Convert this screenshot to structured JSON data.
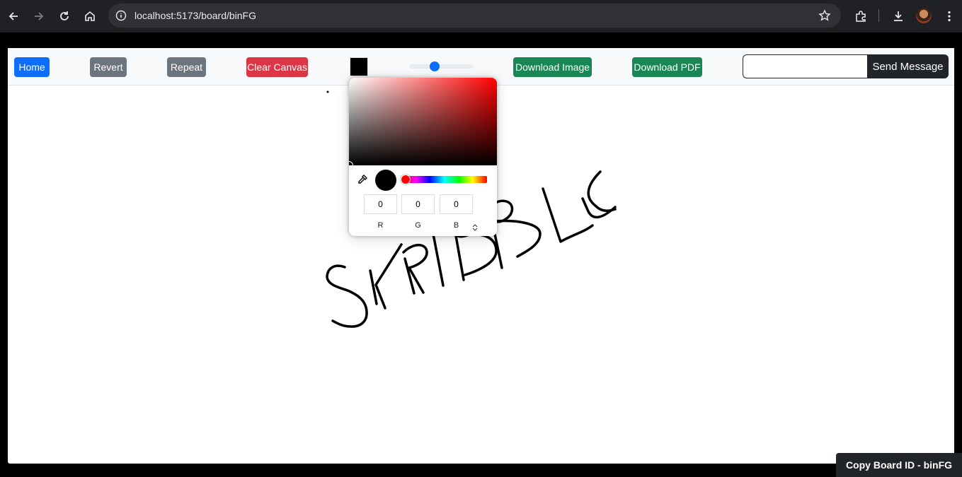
{
  "browser": {
    "url": "localhost:5173/board/binFG"
  },
  "toolbar": {
    "home_label": "Home",
    "revert_label": "Revert",
    "repeat_label": "Repeat",
    "clear_label": "Clear Canvas",
    "download_image_label": "Download Image",
    "download_pdf_label": "Download PDF",
    "send_message_label": "Send Message",
    "message_value": "",
    "selected_color": "#000000",
    "brush_size_fraction": 0.4
  },
  "color_picker": {
    "r": "0",
    "g": "0",
    "b": "0",
    "r_label": "R",
    "g_label": "G",
    "b_label": "B",
    "hue_color": "#ff0000"
  },
  "canvas": {
    "drawn_text": "SKRIBBLE"
  },
  "footer": {
    "copy_board_label": "Copy Board ID - binFG"
  },
  "colors": {
    "primary": "#0d6efd",
    "secondary": "#6c757d",
    "danger": "#dc3545",
    "success": "#198754",
    "dark": "#212529"
  }
}
